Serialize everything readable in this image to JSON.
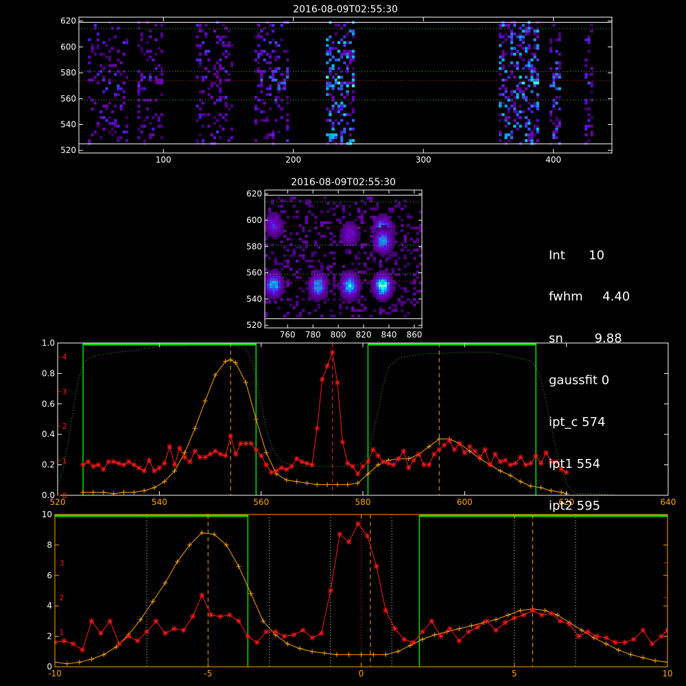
{
  "colors": {
    "background": "#000000",
    "axes": "#ffffff",
    "red_curve": "#ff1a1a",
    "orange_curve": "#ffa500",
    "green": "#00e000",
    "grid_green": "#40c040",
    "grid_red": "#c02020"
  },
  "params": [
    {
      "label": "Int",
      "value": "10"
    },
    {
      "label": "fwhm",
      "value": "4.40"
    },
    {
      "label": "sn",
      "value": "9.88"
    },
    {
      "label": "gaussfit",
      "value": "0"
    },
    {
      "label": "ipt_c",
      "value": "574"
    },
    {
      "label": "ipt1",
      "value": "554"
    },
    {
      "label": "ipt2",
      "value": "595"
    }
  ],
  "chart_data": [
    {
      "type": "heatmap",
      "title": "2016-08-09T02:55:30",
      "xlim": [
        35,
        445
      ],
      "ylim": [
        518,
        623
      ],
      "xticks": [
        100,
        200,
        300,
        400
      ],
      "yticks": [
        520,
        540,
        560,
        580,
        600,
        620
      ],
      "hlines_white": [
        525,
        619
      ],
      "hlines_green": [
        559,
        581,
        614
      ],
      "hlines_red": [
        574
      ],
      "bands": [
        {
          "x": [
            42,
            72
          ],
          "intensity": 0.5
        },
        {
          "x": [
            80,
            98
          ],
          "intensity": 0.45
        },
        {
          "x": [
            125,
            153
          ],
          "intensity": 0.5
        },
        {
          "x": [
            170,
            196
          ],
          "intensity": 0.55
        },
        {
          "x": [
            225,
            247
          ],
          "intensity": 0.9
        },
        {
          "x": [
            358,
            389
          ],
          "intensity": 0.85
        },
        {
          "x": [
            397,
            405
          ],
          "intensity": 0.7
        },
        {
          "x": [
            424,
            429
          ],
          "intensity": 0.5
        }
      ]
    },
    {
      "type": "heatmap",
      "title": "2016-08-09T02:55:30",
      "xlim": [
        742,
        866
      ],
      "ylim": [
        518,
        623
      ],
      "xticks": [
        760,
        780,
        800,
        820,
        840,
        860
      ],
      "yticks": [
        520,
        540,
        560,
        580,
        600,
        620
      ],
      "hlines_white": [
        525,
        619
      ],
      "hlines_green": [
        559,
        581,
        614
      ],
      "hlines_red": [
        554,
        595
      ],
      "hot_spots": [
        {
          "x": 748,
          "y": 552,
          "intensity": 0.8
        },
        {
          "x": 783,
          "y": 551,
          "intensity": 0.75
        },
        {
          "x": 808,
          "y": 551,
          "intensity": 0.85
        },
        {
          "x": 834,
          "y": 551,
          "intensity": 1.0
        },
        {
          "x": 748,
          "y": 597,
          "intensity": 0.45
        },
        {
          "x": 808,
          "y": 590,
          "intensity": 0.4
        },
        {
          "x": 834,
          "y": 594,
          "intensity": 0.8
        },
        {
          "x": 834,
          "y": 585,
          "intensity": 0.7
        }
      ]
    },
    {
      "type": "line",
      "xlim": [
        520,
        640
      ],
      "ylim": [
        0,
        1.0
      ],
      "xticks": [
        520,
        540,
        560,
        580,
        600,
        620,
        640
      ],
      "yticks": [
        0.0,
        0.2,
        0.4,
        0.6,
        0.8,
        1.0
      ],
      "right_yticks": [
        0,
        1,
        2,
        3,
        4
      ],
      "right_ymax": 4.4,
      "green_boxes": [
        [
          525,
          559
        ],
        [
          581,
          614
        ]
      ],
      "vlines_orange": [
        554,
        595
      ],
      "vlines_red": [
        574
      ],
      "series": [
        {
          "color": "green_dotted",
          "x": [
            520,
            521,
            522,
            523,
            524,
            525,
            526,
            528,
            530,
            532,
            535,
            538,
            541,
            544,
            547,
            550,
            553,
            555,
            557,
            558,
            559,
            560,
            561,
            562,
            563,
            564,
            566,
            568,
            570,
            572,
            575,
            577,
            578,
            579,
            580,
            581,
            582,
            583,
            584,
            585,
            587,
            590,
            593,
            596,
            599,
            602,
            605,
            608,
            611,
            613,
            614,
            615,
            616,
            617,
            618,
            619,
            620,
            621,
            622,
            625,
            630,
            635,
            640
          ],
          "y": [
            0.08,
            0.16,
            0.34,
            0.55,
            0.75,
            0.86,
            0.9,
            0.92,
            0.93,
            0.94,
            0.95,
            0.97,
            0.98,
            0.98,
            0.99,
            0.99,
            0.99,
            0.98,
            0.96,
            0.9,
            0.78,
            0.6,
            0.44,
            0.33,
            0.26,
            0.22,
            0.2,
            0.19,
            0.19,
            0.19,
            0.19,
            0.19,
            0.19,
            0.2,
            0.22,
            0.28,
            0.4,
            0.56,
            0.72,
            0.84,
            0.9,
            0.92,
            0.93,
            0.93,
            0.94,
            0.94,
            0.94,
            0.92,
            0.9,
            0.88,
            0.84,
            0.76,
            0.62,
            0.46,
            0.3,
            0.17,
            0.08,
            0.03,
            0.01,
            0.01,
            0.0,
            0.0,
            0.0
          ]
        },
        {
          "color": "orange",
          "x": [
            525,
            527,
            529,
            531,
            533,
            535,
            537,
            539,
            541,
            543,
            545,
            547,
            549,
            551,
            553,
            554,
            555,
            557,
            559,
            561,
            563,
            565,
            567,
            569,
            571,
            573,
            575,
            577,
            579,
            581,
            583,
            585,
            587,
            589,
            591,
            593,
            595,
            597,
            599,
            601,
            603,
            605,
            607,
            609,
            611,
            613,
            615,
            617,
            619,
            620
          ],
          "y": [
            0.02,
            0.02,
            0.02,
            0.01,
            0.02,
            0.02,
            0.03,
            0.05,
            0.09,
            0.16,
            0.28,
            0.44,
            0.62,
            0.79,
            0.88,
            0.89,
            0.87,
            0.74,
            0.5,
            0.28,
            0.14,
            0.1,
            0.09,
            0.08,
            0.07,
            0.07,
            0.07,
            0.07,
            0.08,
            0.14,
            0.2,
            0.23,
            0.24,
            0.24,
            0.27,
            0.32,
            0.37,
            0.37,
            0.34,
            0.29,
            0.24,
            0.2,
            0.16,
            0.13,
            0.09,
            0.06,
            0.05,
            0.03,
            0.02,
            0.01
          ]
        },
        {
          "color": "red",
          "x": [
            525,
            526,
            527,
            528,
            529,
            530,
            531,
            532,
            533,
            534,
            535,
            536,
            537,
            538,
            539,
            540,
            541,
            542,
            543,
            544,
            545,
            546,
            547,
            548,
            549,
            550,
            551,
            552,
            553,
            554,
            555,
            556,
            557,
            558,
            559,
            560,
            561,
            562,
            563,
            564,
            565,
            566,
            567,
            568,
            569,
            570,
            571,
            572,
            573,
            574,
            575,
            576,
            577,
            578,
            579,
            580,
            581,
            582,
            583,
            584,
            585,
            586,
            587,
            588,
            589,
            590,
            591,
            592,
            593,
            594,
            595,
            596,
            597,
            598,
            599,
            600,
            601,
            602,
            603,
            604,
            605,
            606,
            607,
            608,
            609,
            610,
            611,
            612,
            613,
            614,
            615,
            616,
            617,
            618,
            619,
            620
          ],
          "y": [
            0.2,
            0.22,
            0.19,
            0.2,
            0.17,
            0.22,
            0.22,
            0.21,
            0.2,
            0.22,
            0.2,
            0.18,
            0.16,
            0.23,
            0.16,
            0.18,
            0.21,
            0.32,
            0.2,
            0.31,
            0.25,
            0.22,
            0.29,
            0.25,
            0.25,
            0.27,
            0.29,
            0.27,
            0.26,
            0.39,
            0.27,
            0.34,
            0.34,
            0.34,
            0.3,
            0.26,
            0.2,
            0.15,
            0.16,
            0.18,
            0.17,
            0.19,
            0.24,
            0.22,
            0.21,
            0.2,
            0.44,
            0.76,
            0.85,
            0.94,
            0.74,
            0.35,
            0.21,
            0.19,
            0.14,
            0.19,
            0.22,
            0.3,
            0.26,
            0.22,
            0.21,
            0.2,
            0.24,
            0.29,
            0.18,
            0.23,
            0.27,
            0.2,
            0.2,
            0.27,
            0.3,
            0.33,
            0.36,
            0.3,
            0.34,
            0.28,
            0.32,
            0.29,
            0.25,
            0.3,
            0.2,
            0.27,
            0.22,
            0.23,
            0.2,
            0.21,
            0.25,
            0.2,
            0.21,
            0.26,
            0.21,
            0.28,
            0.22,
            0.22,
            0.17,
            0.15
          ]
        }
      ]
    },
    {
      "type": "line",
      "xlim": [
        -10,
        10
      ],
      "ylim": [
        0,
        10
      ],
      "xticks": [
        -10,
        -5,
        0,
        5,
        10
      ],
      "yticks": [
        0,
        2,
        4,
        6,
        8,
        10
      ],
      "right_yticks": [
        1,
        2,
        3
      ],
      "right_ymax": 4.4,
      "green_boxes": [
        [
          -19,
          -3.7
        ],
        [
          1.9,
          15
        ]
      ],
      "vlines_white_dotted": [
        -7,
        -3,
        -1,
        1,
        5,
        7
      ],
      "vlines_orange": [
        -5,
        0.3,
        5.6
      ],
      "vlines_red": [
        0
      ],
      "series": [
        {
          "color": "orange",
          "x": [
            -10,
            -9.6,
            -9.2,
            -8.8,
            -8.4,
            -8.0,
            -7.6,
            -7.2,
            -6.8,
            -6.4,
            -6.0,
            -5.6,
            -5.2,
            -4.8,
            -4.4,
            -4.0,
            -3.6,
            -3.2,
            -2.8,
            -2.4,
            -2.0,
            -1.6,
            -1.2,
            -0.8,
            -0.4,
            0.0,
            0.4,
            0.8,
            1.2,
            1.6,
            2.0,
            2.4,
            2.8,
            3.2,
            3.6,
            4.0,
            4.4,
            4.8,
            5.2,
            5.6,
            6.0,
            6.4,
            6.8,
            7.2,
            7.6,
            8.0,
            8.4,
            8.8,
            9.2,
            9.6,
            10.0
          ],
          "y": [
            0.3,
            0.2,
            0.3,
            0.5,
            0.8,
            1.3,
            2.1,
            3.1,
            4.3,
            5.5,
            6.9,
            8.0,
            8.8,
            8.7,
            8.0,
            6.6,
            4.8,
            3.0,
            2.1,
            1.5,
            1.2,
            1.0,
            0.9,
            0.8,
            0.8,
            0.8,
            0.8,
            0.8,
            1.0,
            1.4,
            1.8,
            2.1,
            2.3,
            2.5,
            2.7,
            2.9,
            3.1,
            3.4,
            3.7,
            3.8,
            3.7,
            3.4,
            2.9,
            2.4,
            1.9,
            1.5,
            1.1,
            0.8,
            0.6,
            0.4,
            0.3
          ]
        },
        {
          "color": "red",
          "x": [
            -10,
            -9.7,
            -9.4,
            -9.1,
            -8.8,
            -8.5,
            -8.2,
            -7.9,
            -7.6,
            -7.3,
            -7.0,
            -6.7,
            -6.4,
            -6.1,
            -5.8,
            -5.5,
            -5.2,
            -4.9,
            -4.6,
            -4.3,
            -4.0,
            -3.7,
            -3.4,
            -3.1,
            -2.8,
            -2.5,
            -2.2,
            -1.9,
            -1.6,
            -1.3,
            -1.0,
            -0.7,
            -0.4,
            -0.1,
            0.2,
            0.5,
            0.8,
            1.1,
            1.4,
            1.7,
            2.0,
            2.3,
            2.6,
            2.9,
            3.2,
            3.5,
            3.8,
            4.1,
            4.4,
            4.7,
            5.0,
            5.3,
            5.6,
            5.9,
            6.2,
            6.5,
            6.8,
            7.1,
            7.4,
            7.7,
            8.0,
            8.3,
            8.6,
            8.9,
            9.2,
            9.5,
            9.8,
            10.0
          ],
          "y": [
            1.6,
            1.7,
            1.5,
            1.1,
            3.0,
            2.2,
            3.0,
            1.5,
            2.0,
            1.7,
            2.3,
            3.0,
            2.2,
            2.5,
            2.4,
            3.3,
            4.7,
            3.4,
            3.3,
            3.4,
            3.0,
            2.0,
            1.6,
            2.3,
            2.3,
            2.0,
            2.1,
            2.4,
            1.9,
            2.2,
            5.0,
            8.7,
            8.2,
            9.4,
            8.6,
            6.6,
            3.7,
            2.5,
            1.8,
            1.6,
            2.3,
            3.0,
            2.0,
            2.5,
            1.7,
            2.3,
            2.6,
            3.0,
            2.4,
            2.9,
            3.2,
            3.4,
            3.7,
            3.4,
            3.5,
            3.0,
            2.8,
            2.0,
            2.3,
            2.0,
            1.9,
            1.6,
            1.6,
            1.8,
            2.4,
            1.5,
            2.0,
            2.4
          ]
        }
      ]
    }
  ]
}
